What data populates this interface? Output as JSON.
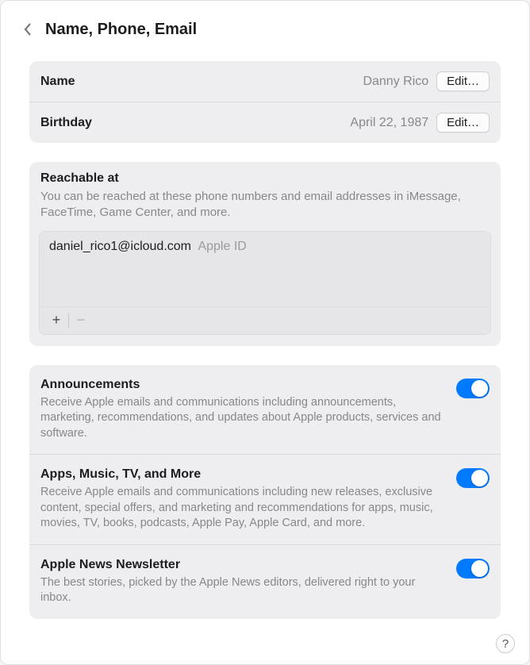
{
  "header": {
    "title": "Name, Phone, Email"
  },
  "personal": {
    "name_label": "Name",
    "name_value": "Danny Rico",
    "name_edit": "Edit…",
    "birthday_label": "Birthday",
    "birthday_value": "April 22, 1987",
    "birthday_edit": "Edit…"
  },
  "reachable": {
    "title": "Reachable at",
    "desc": "You can be reached at these phone numbers and email addresses in iMessage, FaceTime, Game Center, and more.",
    "items": [
      {
        "value": "daniel_rico1@icloud.com",
        "type": "Apple ID"
      }
    ],
    "plus": "+",
    "minus": "−"
  },
  "notifications": {
    "announcements": {
      "title": "Announcements",
      "desc": "Receive Apple emails and communications including announcements, marketing, recommendations, and updates about Apple products, services and software.",
      "on": true
    },
    "apps": {
      "title": "Apps, Music, TV, and More",
      "desc": "Receive Apple emails and communications including new releases, exclusive content, special offers, and marketing and recommendations for apps, music, movies, TV, books, podcasts, Apple Pay, Apple Card, and more.",
      "on": true
    },
    "news": {
      "title": "Apple News Newsletter",
      "desc": "The best stories, picked by the Apple News editors, delivered right to your inbox.",
      "on": true
    }
  },
  "help": "?"
}
